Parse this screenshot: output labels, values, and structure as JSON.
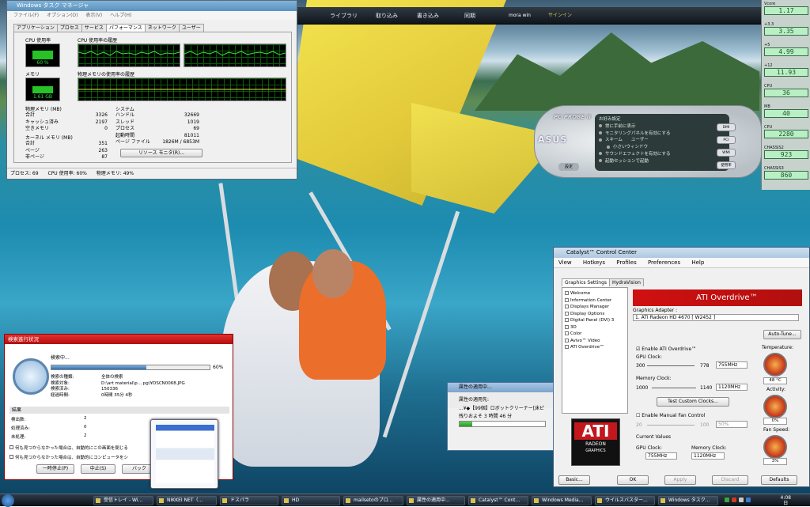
{
  "media_bar": {
    "nav": [
      "ライブラリ",
      "取り込み",
      "書き込み",
      "同期",
      "mora win",
      "サインイン"
    ]
  },
  "task_manager": {
    "title": "Windows タスク マネージャ",
    "menu": [
      "ファイル(F)",
      "オプション(O)",
      "表示(V)",
      "ヘルプ(H)"
    ],
    "tabs": [
      "アプリケーション",
      "プロセス",
      "サービス",
      "パフォーマンス",
      "ネットワーク",
      "ユーザー"
    ],
    "active_tab": "パフォーマンス",
    "cpu_label": "CPU 使用率",
    "cpu_history_label": "CPU 使用率の履歴",
    "cpu_value": "60 %",
    "cpu_percent": 60,
    "mem_label": "メモリ",
    "mem_history_label": "物理メモリの使用率の履歴",
    "mem_value": "1.61 GB",
    "mem_fraction": 0.49,
    "physical_memory_title": "物理メモリ (MB)",
    "physical_memory": [
      {
        "k": "合計",
        "v": "3326"
      },
      {
        "k": "キャッシュ済み",
        "v": "2197"
      },
      {
        "k": "空きメモリ",
        "v": "0"
      }
    ],
    "kernel_memory_title": "カーネル メモリ (MB)",
    "kernel_memory": [
      {
        "k": "合計",
        "v": "351"
      },
      {
        "k": "ページ",
        "v": "263"
      },
      {
        "k": "非ページ",
        "v": "87"
      }
    ],
    "system_title": "システム",
    "system": [
      {
        "k": "ハンドル",
        "v": "32669"
      },
      {
        "k": "スレッド",
        "v": "1019"
      },
      {
        "k": "プロセス",
        "v": "69"
      },
      {
        "k": "起動時間",
        "v": "81011"
      },
      {
        "k": "ページ ファイル",
        "v": "1826M / 6853M"
      }
    ],
    "resource_monitor_button": "リソース モニタ(R)...",
    "status": [
      "プロセス: 69",
      "CPU 使用率: 60%",
      "物理メモリ: 49%"
    ]
  },
  "voltage_gadget": {
    "rows": [
      {
        "name": "Vcore",
        "value": "1.17"
      },
      {
        "name": "+3.3",
        "value": "3.35"
      },
      {
        "name": "+5",
        "value": "4.99"
      },
      {
        "name": "+12",
        "value": "11.93"
      },
      {
        "name": "CPU",
        "value": "36"
      },
      {
        "name": "MB",
        "value": "40"
      },
      {
        "name": "CPU",
        "value": "2280"
      },
      {
        "name": "CHASSIS2",
        "value": "923"
      },
      {
        "name": "CHASSIS3",
        "value": "860"
      }
    ]
  },
  "pc_probe": {
    "title": "PC PROBE II",
    "brand": "ASUS",
    "settings_header": "お好み設定",
    "options": [
      "常に手前に表示",
      "モニタリングパネルを有効にする",
      "スキーム　　ユーザー",
      "小さいウィンドウ",
      "サウンドエフェクトを有効にする",
      "起動セッションで起動"
    ],
    "settings_button": "設定",
    "right_buttons": [
      "DMI",
      "PCI",
      "WMI",
      "使用率"
    ]
  },
  "catalyst": {
    "title": "Catalyst™ Control Center",
    "menu": [
      "View",
      "Hotkeys",
      "Profiles",
      "Preferences",
      "Help"
    ],
    "tabs": [
      "Graphics Settings",
      "HydraVision"
    ],
    "tree": [
      "Welcome",
      "Information Center",
      "Displays Manager",
      "Display Options",
      "Digital Panel (DVI) 3",
      "3D",
      "Color",
      "Avivo™ Video",
      "ATI Overdrive™"
    ],
    "logo_text": "ATI",
    "logo_sub1": "RADEON",
    "logo_sub2": "GRAPHICS",
    "overdrive_title": "ATI Overdrive™",
    "adapter_label": "Graphics Adapter :",
    "adapter_value": "1. ATI Radeon HD 4670 [ W2452 ]",
    "autotune": "Auto-Tune...",
    "enable_overdrive": "Enable ATI Overdrive™",
    "gpu_clock_label": "GPU Clock:",
    "gpu_min": "300",
    "gpu_max": "778",
    "gpu_value": "755MHz",
    "mem_clock_label": "Memory Clock:",
    "mem_min": "1000",
    "mem_max": "1140",
    "mem_value": "1120MHz",
    "test_clocks": "Test Custom Clocks...",
    "manual_fan": "Enable Manual Fan Control",
    "fan_min": "20",
    "fan_max": "100",
    "fan_value": "50%",
    "current_values": "Current Values",
    "cur_gpu_label": "GPU Clock:",
    "cur_gpu": "755MHz",
    "cur_mem_label": "Memory Clock:",
    "cur_mem": "1120MHz",
    "temperature_label": "Temperature:",
    "temperature": "48 °C",
    "activity_label": "Activity:",
    "activity": "0%",
    "fan_speed_label": "Fan Speed:",
    "fan_speed": "3%",
    "buttons": [
      "Basic...",
      "OK",
      "Apply",
      "Discard",
      "Defaults"
    ]
  },
  "search_dialog": {
    "title": "検索進行状況",
    "status": "検索中...",
    "percent": "60%",
    "fraction": 0.6,
    "rows": [
      {
        "k": "検索の種類:",
        "v": "全体の検索"
      },
      {
        "k": "検索対象:",
        "v": "D:\\art material\\p....pg\\¥DSCN0068.JPG"
      },
      {
        "k": "検索済み:",
        "v": "150336"
      },
      {
        "k": "経過時間:",
        "v": "0時間 35分 4秒"
      }
    ],
    "result_header": "結果",
    "results": [
      {
        "k": "検出数:",
        "v": "2"
      },
      {
        "k": "処理済み:",
        "v": "0"
      },
      {
        "k": "未処理:",
        "v": "2"
      }
    ],
    "checks": [
      "何も見つからなかった場合は、自動的にこの画面を閉じる",
      "何も見つからなかった場合は、自動的にコンピュータをシ"
    ],
    "buttons": [
      "一時停止(P)",
      "中止(S)",
      "バック"
    ]
  },
  "prop_dialog": {
    "title": "属性の適用中...",
    "target_label": "属性の適用先:",
    "target": "...¥◆【99個】ロボットクリーナー[床ピ",
    "remaining": "残りおよそ 3 時間 46 分",
    "fraction": 0.15
  },
  "taskbar": {
    "items": [
      "受信トレイ - Wi...",
      "NIKKEI NET（...",
      "ドスパラ",
      "HD",
      "mailsetoのブロ...",
      "属性の適用中...",
      "Catalyst™ Cont...",
      "Windows Media...",
      "ウイルスバスター...",
      "Windows タスク..."
    ],
    "time": "4:08",
    "date": "日"
  }
}
